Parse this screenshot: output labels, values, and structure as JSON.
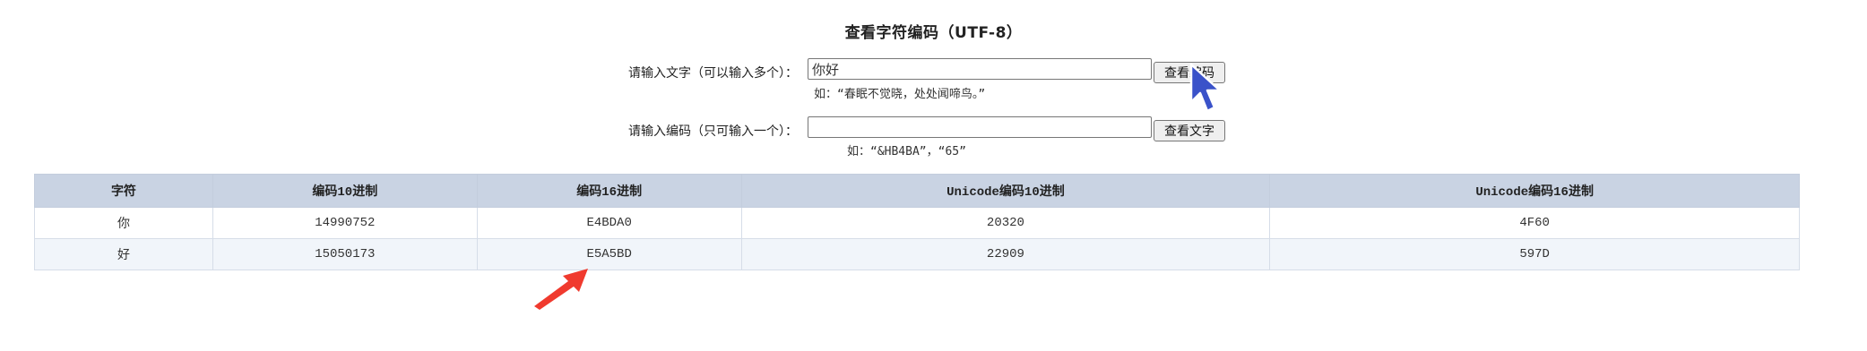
{
  "page": {
    "title": "查看字符编码（UTF-8）"
  },
  "text_to_code": {
    "label": "请输入文字（可以输入多个）：",
    "value": "你好",
    "button": "查看编码",
    "hint": "如：“春眠不觉晓，处处闻啼鸟。”"
  },
  "code_to_text": {
    "label": "请输入编码（只可输入一个）：",
    "value": "",
    "button": "查看文字",
    "hint": "如：“&HB4BA”，“65”"
  },
  "table": {
    "headers": [
      "字符",
      "编码10进制",
      "编码16进制",
      "Unicode编码10进制",
      "Unicode编码16进制"
    ],
    "rows": [
      [
        "你",
        "14990752",
        "E4BDA0",
        "20320",
        "4F60"
      ],
      [
        "好",
        "15050173",
        "E5A5BD",
        "22909",
        "597D"
      ]
    ]
  },
  "colors": {
    "header_bg": "#c9d3e3",
    "row_alt_bg": "#f1f5fa",
    "cursor": "#3a52c9",
    "annotation_arrow": "#f03a2e"
  },
  "icons": {
    "cursor": "mouse-pointer-icon",
    "annotation": "red-arrow-icon"
  }
}
